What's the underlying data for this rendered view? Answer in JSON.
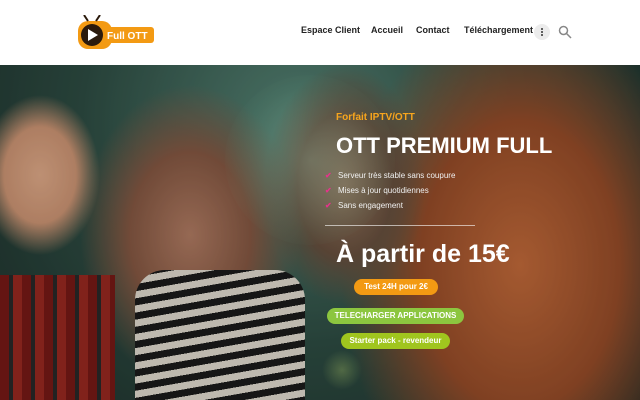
{
  "header": {
    "logo_text": "Full OTT",
    "nav": [
      "Espace Client",
      "Accueil",
      "Contact",
      "Téléchargement"
    ]
  },
  "hero": {
    "eyebrow": "Forfait IPTV/OTT",
    "title": "OTT PREMIUM FULL",
    "features": [
      "Serveur très stable sans coupure",
      "Mises à jour quotidiennes",
      "Sans engagement"
    ],
    "price": "À partir de 15€",
    "buttons": {
      "test": "Test 24H pour 2€",
      "apps": "TELECHARGER APPLICATIONS",
      "pack": "Starter pack - revendeur"
    }
  },
  "colors": {
    "accent_orange": "#f39a13",
    "accent_green": "#8cc63f",
    "check_pink": "#e3348a"
  },
  "icons": [
    "logo-tv-icon",
    "more-vertical-icon",
    "search-icon",
    "check-icon"
  ]
}
